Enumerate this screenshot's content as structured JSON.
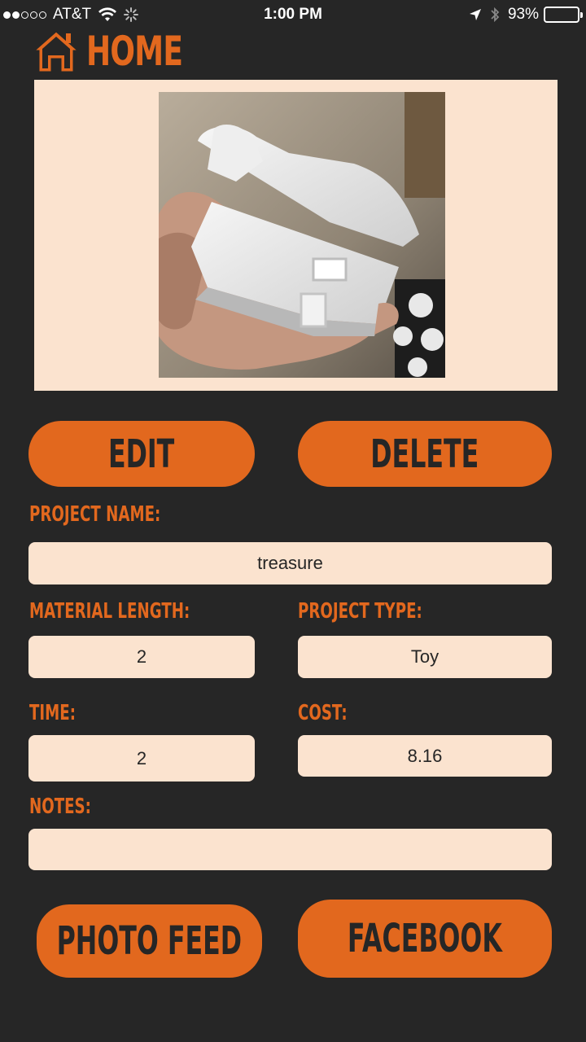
{
  "status_bar": {
    "carrier": "AT&T",
    "time": "1:00 PM",
    "battery": "93%"
  },
  "header": {
    "home_label": "HOME",
    "home_icon": "house-icon"
  },
  "photo": {
    "subject": "treasure"
  },
  "actions": {
    "edit": "EDIT",
    "delete": "DELETE"
  },
  "fields": {
    "project_name": {
      "label": "PROJECT NAME:",
      "value": "treasure"
    },
    "material_length": {
      "label": "MATERIAL LENGTH:",
      "value": "2"
    },
    "project_type": {
      "label": "PROJECT TYPE:",
      "value": "Toy"
    },
    "time": {
      "label": "TIME:",
      "value": "2"
    },
    "cost": {
      "label": "COST:",
      "value": "8.16"
    },
    "notes": {
      "label": "NOTES:",
      "value": ""
    }
  },
  "footer": {
    "photo_feed": "PHOTO FEED",
    "facebook": "FACEBOOK"
  },
  "colors": {
    "background": "#262626",
    "accent": "#e2681e",
    "field_bg": "#fbe3cf"
  }
}
